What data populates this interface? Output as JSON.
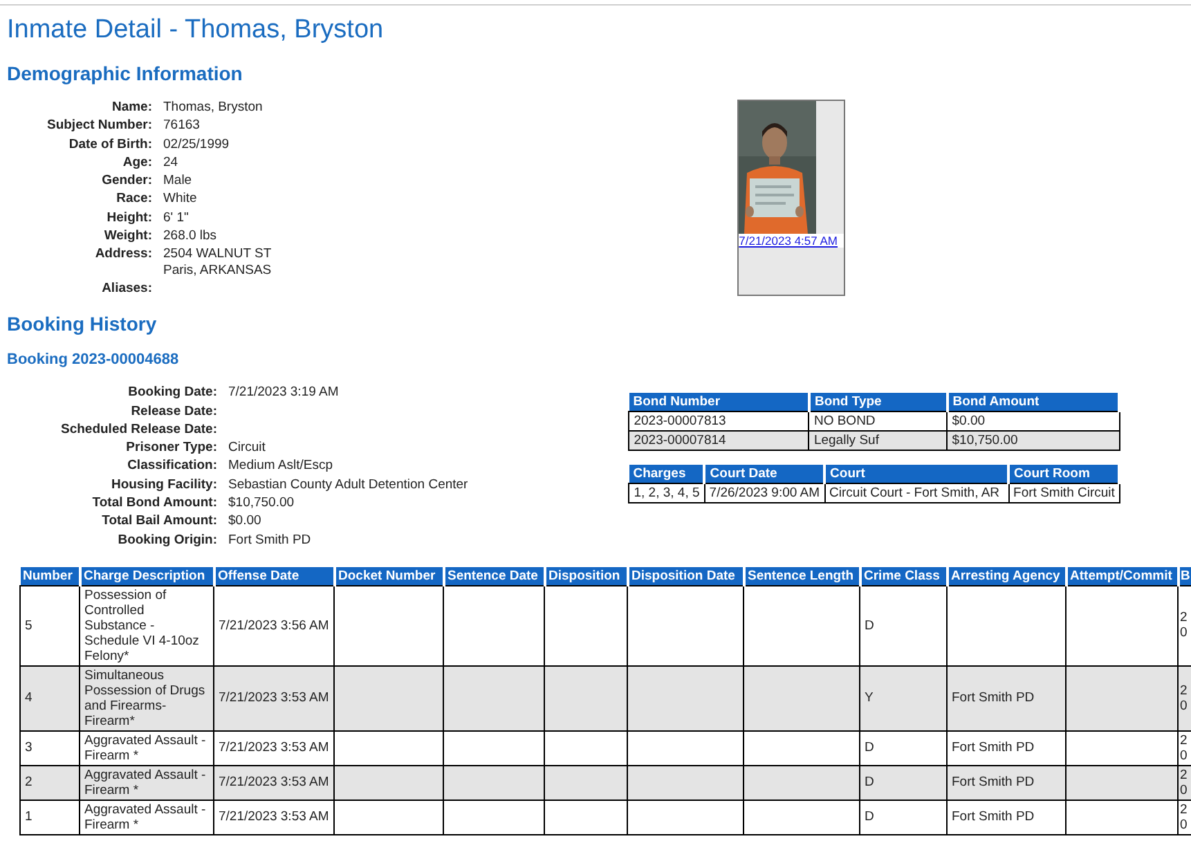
{
  "page_title": "Inmate Detail - Thomas, Bryston",
  "demographics": {
    "heading": "Demographic Information",
    "fields": [
      {
        "label": "Name:",
        "value": "Thomas, Bryston"
      },
      {
        "label": "Subject Number:",
        "value": "76163"
      },
      {
        "label": "Date of Birth:",
        "value": "02/25/1999"
      },
      {
        "label": "Age:",
        "value": "24"
      },
      {
        "label": "Gender:",
        "value": "Male"
      },
      {
        "label": "Race:",
        "value": "White"
      },
      {
        "label": "Height:",
        "value": "6' 1\""
      },
      {
        "label": "Weight:",
        "value": "268.0 lbs"
      },
      {
        "label": "Address:",
        "value": "2504 WALNUT ST",
        "value_line_2": "Paris, ARKANSAS"
      },
      {
        "label": "Aliases:"
      }
    ],
    "photo": {
      "kind": "picture",
      "caption": "7/21/2023 4:57 AM"
    }
  },
  "booking_history": {
    "heading": "Booking History",
    "booking_title": "Booking 2023-00004688",
    "fields": [
      {
        "label": "Booking Date:",
        "value": "7/21/2023 3:19 AM"
      },
      {
        "label": "Release Date:"
      },
      {
        "label": "Scheduled Release Date:"
      },
      {
        "label": "Prisoner Type:",
        "value": "Circuit"
      },
      {
        "label": "Classification:",
        "value": "Medium Aslt/Escp"
      },
      {
        "label": "Housing Facility:",
        "value": "Sebastian County Adult Detention Center"
      },
      {
        "label": "Total Bond Amount:",
        "value": "$10,750.00"
      },
      {
        "label": "Total Bail Amount:",
        "value": "$0.00"
      },
      {
        "label": "Booking Origin:",
        "value": "Fort Smith PD"
      }
    ],
    "bonds": {
      "columns": [
        "Bond Number",
        "Bond Type",
        "Bond Amount"
      ],
      "rows": [
        [
          "2023-00007813",
          "NO BOND",
          "$0.00"
        ],
        [
          "2023-00007814",
          "Legally Suf",
          "$10,750.00"
        ]
      ]
    },
    "court": {
      "columns": [
        "Charges",
        "Court Date",
        "Court",
        "Court Room"
      ],
      "rows": [
        [
          "1, 2, 3, 4, 5",
          "7/26/2023 9:00 AM",
          "Circuit Court - Fort Smith, AR",
          "Fort Smith Circuit"
        ]
      ]
    }
  },
  "charges": {
    "columns": [
      "Number",
      "Charge Description",
      "Offense Date",
      "Docket Number",
      "Sentence Date",
      "Disposition",
      "Disposition Date",
      "Sentence Length",
      "Crime Class",
      "Arresting Agency",
      "Attempt/Commit",
      "B"
    ],
    "rows": [
      [
        "5",
        "Possession of Controlled Substance - Schedule VI 4-10oz Felony*",
        "7/21/2023 3:56 AM",
        "",
        "",
        "",
        "",
        "",
        "D",
        "",
        "",
        "2 0"
      ],
      [
        "4",
        "Simultaneous Possession of Drugs and Firearms-Firearm*",
        "7/21/2023 3:53 AM",
        "",
        "",
        "",
        "",
        "",
        "Y",
        "Fort Smith PD",
        "",
        "2 0"
      ],
      [
        "3",
        "Aggravated Assault - Firearm *",
        "7/21/2023 3:53 AM",
        "",
        "",
        "",
        "",
        "",
        "D",
        "Fort Smith PD",
        "",
        "2 0"
      ],
      [
        "2",
        "Aggravated Assault - Firearm *",
        "7/21/2023 3:53 AM",
        "",
        "",
        "",
        "",
        "",
        "D",
        "Fort Smith PD",
        "",
        "2 0"
      ],
      [
        "1",
        "Aggravated Assault - Firearm *",
        "7/21/2023 3:53 AM",
        "",
        "",
        "",
        "",
        "",
        "D",
        "Fort Smith PD",
        "",
        "2 0"
      ]
    ]
  }
}
